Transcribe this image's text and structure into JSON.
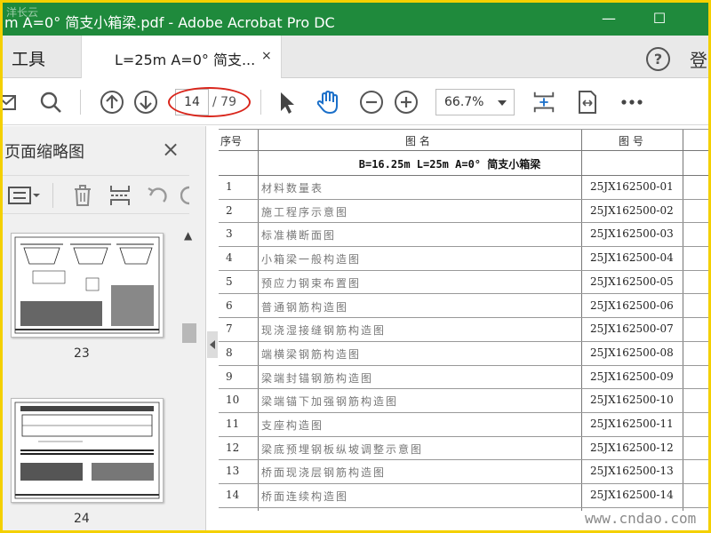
{
  "window": {
    "title": "m A=0° 简支小箱梁.pdf - Adobe Acrobat Pro DC",
    "minimize_label": "—",
    "maximize_label": "☐"
  },
  "tabs": {
    "tools_label": "工具",
    "document_tab_label": "L=25m A=0° 简支...",
    "close_label": "×",
    "help_label": "?",
    "login_label": "登"
  },
  "toolbar": {
    "current_page": "14",
    "total_pages": "/ 79",
    "zoom": "66.7%"
  },
  "thumbnail_panel": {
    "title": "页面缩略图",
    "close_label": "×",
    "thumbnails": [
      {
        "page": "23"
      },
      {
        "page": "24"
      }
    ]
  },
  "document": {
    "headers": {
      "no": "序号",
      "name": "图 名",
      "code": "图 号"
    },
    "subtitle": "B=16.25m L=25m A=0°  简支小箱梁",
    "rows": [
      {
        "no": "1",
        "name": "材料数量表",
        "code": "25JX162500-01"
      },
      {
        "no": "2",
        "name": "施工程序示意图",
        "code": "25JX162500-02"
      },
      {
        "no": "3",
        "name": "标准横断面图",
        "code": "25JX162500-03"
      },
      {
        "no": "4",
        "name": "小箱梁一般构造图",
        "code": "25JX162500-04"
      },
      {
        "no": "5",
        "name": "预应力钢束布置图",
        "code": "25JX162500-05"
      },
      {
        "no": "6",
        "name": "普通钢筋构造图",
        "code": "25JX162500-06"
      },
      {
        "no": "7",
        "name": "现浇湿接缝钢筋构造图",
        "code": "25JX162500-07"
      },
      {
        "no": "8",
        "name": "端横梁钢筋构造图",
        "code": "25JX162500-08"
      },
      {
        "no": "9",
        "name": "梁端封锚钢筋构造图",
        "code": "25JX162500-09"
      },
      {
        "no": "10",
        "name": "梁端锚下加强钢筋构造图",
        "code": "25JX162500-10"
      },
      {
        "no": "11",
        "name": "支座构造图",
        "code": "25JX162500-11"
      },
      {
        "no": "12",
        "name": "梁底预埋钢板纵坡调整示意图",
        "code": "25JX162500-12"
      },
      {
        "no": "13",
        "name": "桥面现浇层钢筋构造图",
        "code": "25JX162500-13"
      },
      {
        "no": "14",
        "name": "桥面连续构造图",
        "code": "25JX162500-14"
      }
    ]
  },
  "watermarks": {
    "top_left": "洋长云",
    "bottom_right": "www.cndao.com"
  },
  "colors": {
    "titlebar": "#1f8a3c",
    "outer_frame": "#f4d000",
    "page_indicator_oval": "#d9261c",
    "hand_tool": "#1a6fc9"
  },
  "icons": [
    "mail-icon",
    "search-icon",
    "page-up-icon",
    "page-down-icon",
    "select-arrow-icon",
    "hand-icon",
    "zoom-out-icon",
    "zoom-in-icon",
    "fit-page-icon",
    "rotate-view-icon",
    "more-icon",
    "options-icon",
    "delete-icon",
    "insert-page-icon",
    "undo-icon"
  ]
}
